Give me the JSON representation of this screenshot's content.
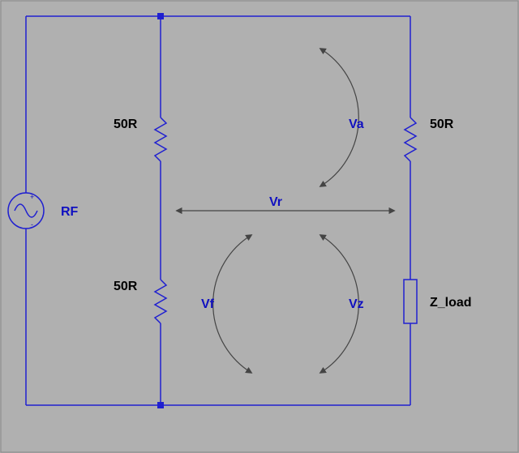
{
  "source": {
    "label": "RF"
  },
  "components": {
    "r_top_left": "50R",
    "r_bottom_left": "50R",
    "r_top_right": "50R",
    "load": "Z_load"
  },
  "voltages": {
    "va": "Va",
    "vr": "Vr",
    "vf": "Vf",
    "vz": "Vz"
  }
}
